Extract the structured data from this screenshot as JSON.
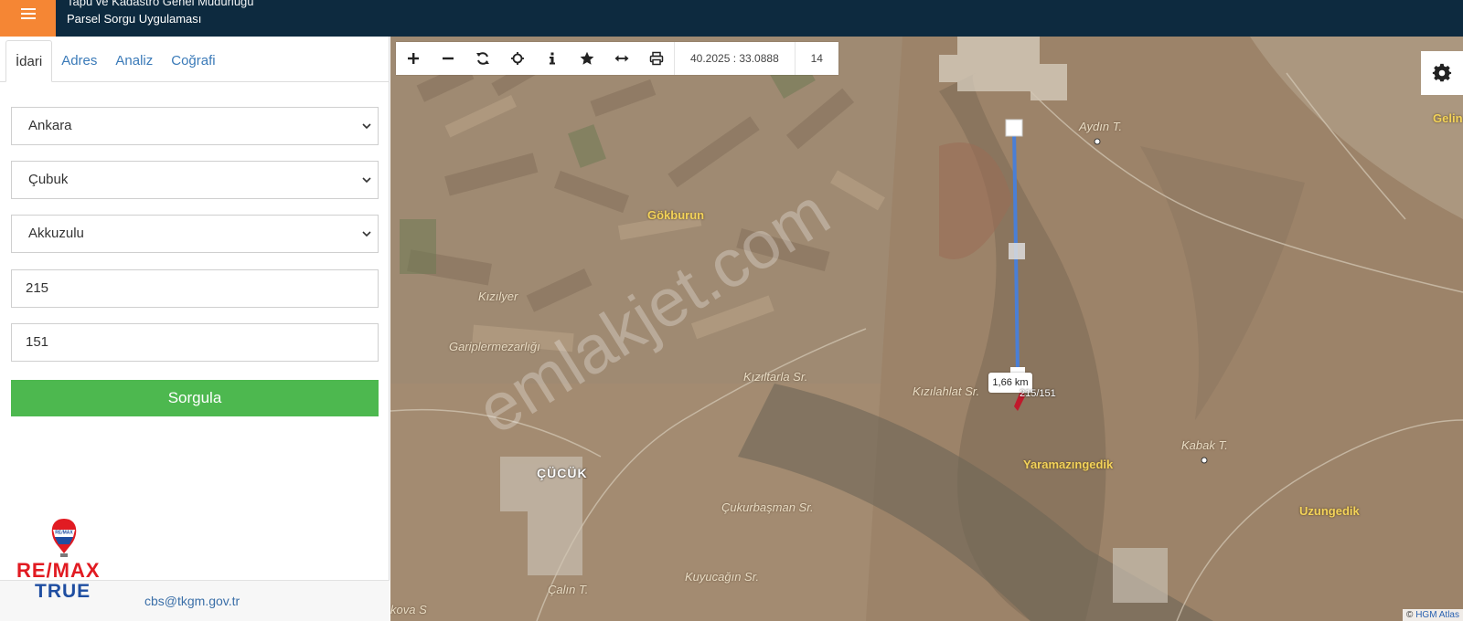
{
  "header": {
    "title_line1": "Tapu ve Kadastro Genel Müdürlüğü",
    "title_line2": "Parsel Sorgu Uygulaması",
    "accent_color": "#f58634",
    "background_color": "#0d2a3f"
  },
  "sidebar": {
    "tabs": [
      {
        "label": "İdari",
        "active": true
      },
      {
        "label": "Adres",
        "active": false
      },
      {
        "label": "Analiz",
        "active": false
      },
      {
        "label": "Coğrafi",
        "active": false
      }
    ],
    "form": {
      "province": "Ankara",
      "district": "Çubuk",
      "neighborhood": "Akkuzulu",
      "block": "215",
      "parcel": "151",
      "submit_label": "Sorgula",
      "submit_color": "#4db84f"
    },
    "logo": {
      "brand_top": "RE/MAX",
      "brand_bottom": "TRUE"
    },
    "footer": {
      "email": "cbs@tkgm.gov.tr"
    }
  },
  "map": {
    "toolbar": {
      "icons": [
        "zoom-in-icon",
        "zoom-out-icon",
        "refresh-icon",
        "locate-icon",
        "info-icon",
        "star-icon",
        "measure-icon",
        "print-icon"
      ],
      "coordinates": "40.2025 : 33.0888",
      "zoom_level": "14"
    },
    "places": {
      "aydin": "Aydın T.",
      "gelin": "Gelin",
      "gokburun": "Gökburun",
      "kiziller": "Kızılyer",
      "gariplermezarligi": "Gariplermezarlığı",
      "kiziltarla": "Kızıltarla Sr.",
      "kizilahlat": "Kızılahlat Sr.",
      "kabak": "Kabak T.",
      "yaramazingedik": "Yaramazıngedik",
      "uzungedik": "Uzungedik",
      "cucuk": "ÇÜCÜK",
      "cukurbasman": "Çukurbaşman Sr.",
      "kuyucagin": "Kuyucağın Sr.",
      "calin": "Çalın T.",
      "kova": "kova S"
    },
    "measurement": {
      "distance": "1,66 km",
      "parcel_label": "215/151",
      "line_color": "#4a7fd6"
    },
    "watermark": "emlakjet.com",
    "attribution_prefix": "© ",
    "attribution_link": "HGM Atlas"
  }
}
